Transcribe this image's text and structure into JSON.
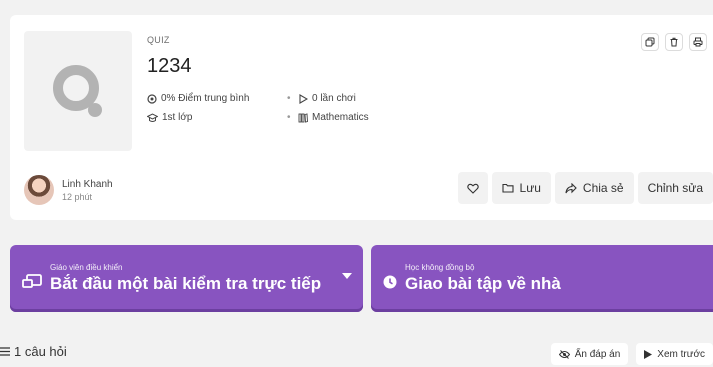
{
  "quiz": {
    "type_label": "QUIZ",
    "title": "1234",
    "accuracy": "0% Điểm trung bình",
    "plays": "0 lần chơi",
    "grade": "1st lớp",
    "subject": "Mathematics",
    "separator": "•"
  },
  "author": {
    "name": "Linh Khanh",
    "time": "12 phút"
  },
  "actions": {
    "save_label": "Lưu",
    "share_label": "Chia sẻ",
    "edit_label": "Chỉnh sửa"
  },
  "live": {
    "small_label": "Giáo viên điều khiển",
    "big_label": "Bắt đầu một bài kiểm tra trực tiếp"
  },
  "homework": {
    "small_label": "Học không đồng bộ",
    "big_label": "Giao bài tập về nhà"
  },
  "footer": {
    "question_count": "1 câu hỏi",
    "hide_answers_label": "Ẩn đáp án",
    "preview_label": "Xem trước"
  },
  "colors": {
    "primary": "#8854c0",
    "background": "#f2f2f2"
  }
}
